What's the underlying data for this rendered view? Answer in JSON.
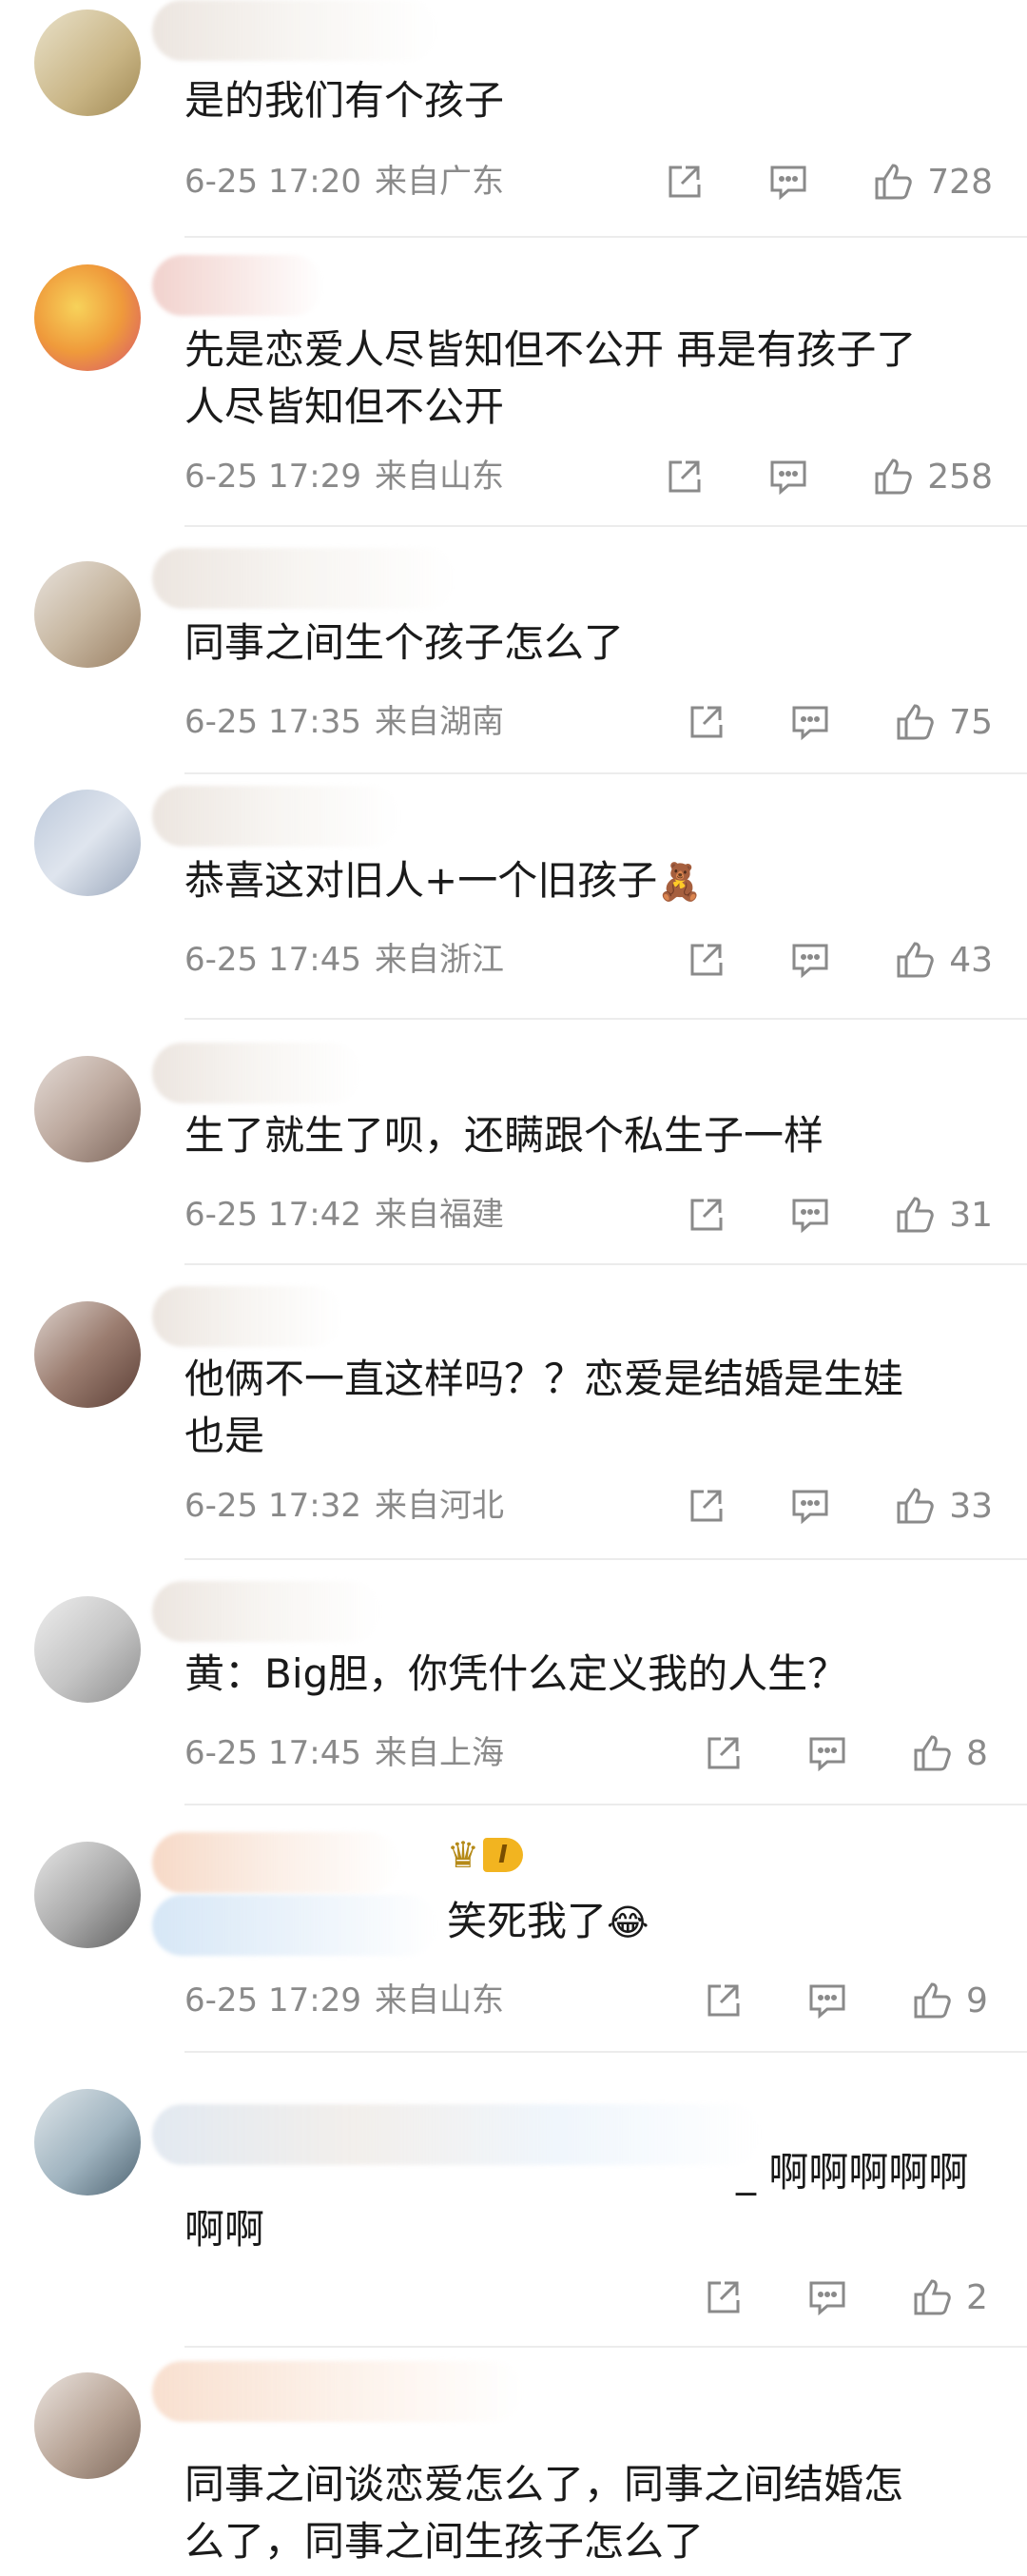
{
  "comments": [
    {
      "text": "是的我们有个孩子",
      "time": "6-25 17:20",
      "location": "来自广东",
      "likes": "728"
    },
    {
      "text": "先是恋爱人尽皆知但不公开 再是有孩子了\n人尽皆知但不公开",
      "time": "6-25 17:29",
      "location": "来自山东",
      "likes": "258"
    },
    {
      "text": "同事之间生个孩子怎么了",
      "time": "6-25 17:35",
      "location": "来自湖南",
      "likes": "75"
    },
    {
      "text": "恭喜这对旧人+一个旧孩子",
      "emoji": "🧸",
      "time": "6-25 17:45",
      "location": "来自浙江",
      "likes": "43"
    },
    {
      "text": "生了就生了呗，还瞒跟个私生子一样",
      "time": "6-25 17:42",
      "location": "来自福建",
      "likes": "31"
    },
    {
      "text": "他俩不一直这样吗？？恋爱是结婚是生娃\n也是",
      "time": "6-25 17:32",
      "location": "来自河北",
      "likes": "33"
    },
    {
      "text": "黄：Big胆，你凭什么定义我的人生？",
      "time": "6-25 17:45",
      "location": "来自上海",
      "likes": "8"
    },
    {
      "text": "笑死我了",
      "emoji": "😂",
      "badge_level": "I",
      "time": "6-25 17:29",
      "location": "来自山东",
      "likes": "9"
    },
    {
      "text": "_ 啊啊啊啊啊\n啊啊",
      "time": "",
      "location": "",
      "likes": "2"
    },
    {
      "text": "同事之间谈恋爱怎么了，同事之间结婚怎\n么了，同事之间生孩子怎么了",
      "time": "",
      "location": "",
      "likes": ""
    }
  ],
  "icons": {
    "share": "share-icon",
    "reply": "reply-icon",
    "like": "thumbs-up-icon"
  },
  "colors": {
    "text": "#1a1a1a",
    "meta": "#8a8a8a",
    "divider": "#ececec",
    "icon": "#8a8a8a",
    "badge": "#f2b420"
  }
}
